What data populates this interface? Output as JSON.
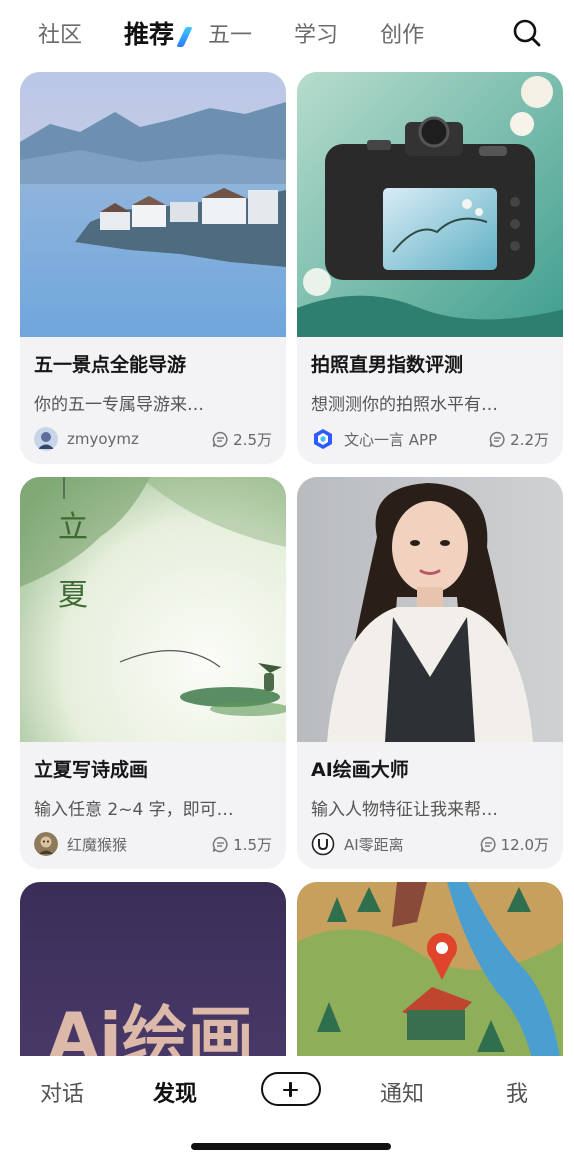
{
  "top_tabs": [
    "社区",
    "推荐",
    "五一",
    "学习",
    "创作"
  ],
  "cards": [
    {
      "title": "五一景点全能导游",
      "desc": "你的五一专属导游来…",
      "author": "zmyoymz",
      "count": "2.5万"
    },
    {
      "title": "拍照直男指数评测",
      "desc": "想测测你的拍照水平有…",
      "author": "文心一言 APP",
      "count": "2.2万"
    },
    {
      "title": "立夏写诗成画",
      "desc": "输入任意 2~4 字，即可…",
      "author": "红魔猴猴",
      "count": "1.5万"
    },
    {
      "title": "AI绘画大师",
      "desc": "输入人物特征让我来帮…",
      "author": "AI零距离",
      "count": "12.0万"
    },
    {
      "poster_text": "Ai绘画"
    }
  ],
  "solar_term_text": "立夏",
  "bottom_nav": {
    "chat": "对话",
    "discover": "发现",
    "notify": "通知",
    "me": "我"
  }
}
